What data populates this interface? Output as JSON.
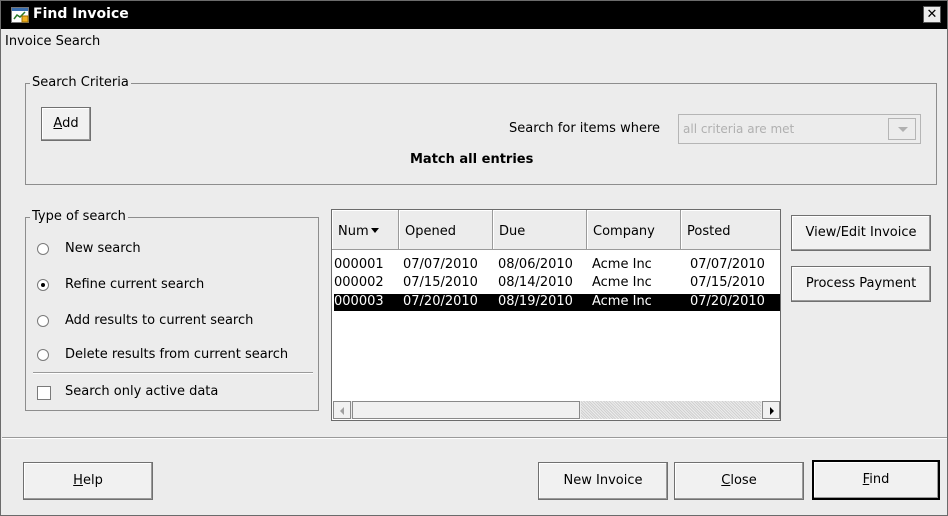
{
  "window": {
    "title": "Find Invoice",
    "close_glyph": "✕"
  },
  "subtitle": "Invoice Search",
  "criteria": {
    "group_label": "Search Criteria",
    "add_button": {
      "accel": "A",
      "rest": "dd"
    },
    "search_for_label": "Search for items where",
    "combo_value": "all criteria are met",
    "match_text": "Match all entries"
  },
  "search_type": {
    "group_label": "Type of search",
    "options": [
      {
        "label": "New search",
        "selected": false
      },
      {
        "label": "Refine current search",
        "selected": true
      },
      {
        "label": "Add results to current search",
        "selected": false
      },
      {
        "label": "Delete results from current search",
        "selected": false
      }
    ],
    "active_only": {
      "label": "Search only active data",
      "checked": false
    }
  },
  "results": {
    "columns": [
      "Num",
      "Opened",
      "Due",
      "Company",
      "Posted"
    ],
    "sort_column": "Num",
    "rows": [
      {
        "num": "000001",
        "opened": "07/07/2010",
        "due": "08/06/2010",
        "company": "Acme Inc",
        "posted": "07/07/2010",
        "selected": false
      },
      {
        "num": "000002",
        "opened": "07/15/2010",
        "due": "08/14/2010",
        "company": "Acme Inc",
        "posted": "07/15/2010",
        "selected": false
      },
      {
        "num": "000003",
        "opened": "07/20/2010",
        "due": "08/19/2010",
        "company": "Acme Inc",
        "posted": "07/20/2010",
        "selected": true
      }
    ]
  },
  "side_buttons": {
    "view_edit": "View/Edit Invoice",
    "process_payment": "Process Payment"
  },
  "footer": {
    "help": {
      "accel": "H",
      "rest": "elp"
    },
    "new_invoice": "New Invoice",
    "close": {
      "accel": "C",
      "rest": "lose"
    },
    "find": {
      "accel": "F",
      "rest": "ind"
    }
  },
  "colors": {
    "title_bar": "#000000",
    "dialog_bg": "#ececec",
    "selection": "#000000"
  },
  "icons": [
    "invoice-window-icon",
    "close-icon",
    "sort-descending-icon",
    "scroll-left-icon",
    "scroll-right-icon",
    "combo-dropdown-icon"
  ]
}
